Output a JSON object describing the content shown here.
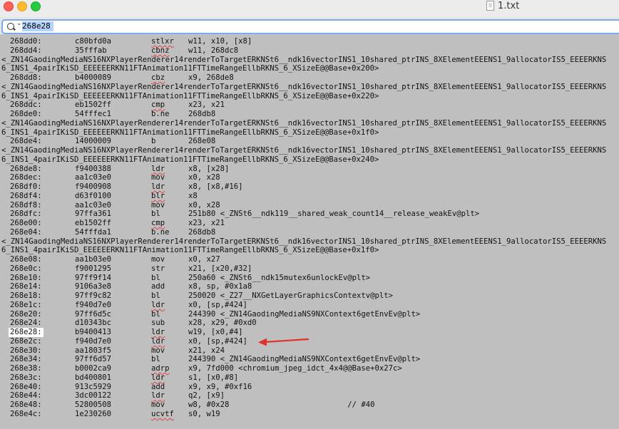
{
  "window": {
    "title": "1.txt"
  },
  "search": {
    "value": "268e28"
  },
  "lines": [
    {
      "type": "insn",
      "addr": "268dd0:",
      "hex": "c80bfd0a",
      "mn": "stlxr",
      "ops": "w11, x10, [x8]",
      "ul": true
    },
    {
      "type": "insn",
      "addr": "268dd4:",
      "hex": "35fffab",
      "mn": "cbnz",
      "ops": "w11, 268dc8",
      "ul": true
    },
    {
      "type": "sym",
      "text": "<_ZN14GaodingMediaNS16NXPlayerRenderer14renderToTargetERKNSt6__ndk16vectorINS1_10shared_ptrINS_8XElementEEENS1_9allocatorIS5_EEEERKNS"
    },
    {
      "type": "sym",
      "text": "6_INS1_4pairIKiSD_EEEEEERKN11FTAnimation11FTTimeRangeEllbRKNS_6_XSizeE@@Base+0x200>"
    },
    {
      "type": "insn",
      "addr": "268dd8:",
      "hex": "b4000089",
      "mn": "cbz",
      "ops": "x9, 268de8",
      "ul": true
    },
    {
      "type": "sym",
      "text": "<_ZN14GaodingMediaNS16NXPlayerRenderer14renderToTargetERKNSt6__ndk16vectorINS1_10shared_ptrINS_8XElementEEENS1_9allocatorIS5_EEEERKNS"
    },
    {
      "type": "sym",
      "text": "6_INS1_4pairIKiSD_EEEEEERKN11FTAnimation11FTTimeRangeEllbRKNS_6_XSizeE@@Base+0x220>"
    },
    {
      "type": "insn",
      "addr": "268ddc:",
      "hex": "eb1502ff",
      "mn": "cmp",
      "ops": "x23, x21",
      "ul": true
    },
    {
      "type": "insn",
      "addr": "268de0:",
      "hex": "54fffec1",
      "mn": "b.ne",
      "ops": "268db8",
      "ul": false
    },
    {
      "type": "sym",
      "text": "<_ZN14GaodingMediaNS16NXPlayerRenderer14renderToTargetERKNSt6__ndk16vectorINS1_10shared_ptrINS_8XElementEEENS1_9allocatorIS5_EEEERKNS"
    },
    {
      "type": "sym",
      "text": "6_INS1_4pairIKiSD_EEEEEERKN11FTAnimation11FTTimeRangeEllbRKNS_6_XSizeE@@Base+0x1f0>"
    },
    {
      "type": "insn",
      "addr": "268de4:",
      "hex": "14000009",
      "mn": "b",
      "ops": "268e08",
      "ul": false
    },
    {
      "type": "sym",
      "text": "<_ZN14GaodingMediaNS16NXPlayerRenderer14renderToTargetERKNSt6__ndk16vectorINS1_10shared_ptrINS_8XElementEEENS1_9allocatorIS5_EEEERKNS"
    },
    {
      "type": "sym",
      "text": "6_INS1_4pairIKiSD_EEEEEERKN11FTAnimation11FTTimeRangeEllbRKNS_6_XSizeE@@Base+0x240>"
    },
    {
      "type": "insn",
      "addr": "268de8:",
      "hex": "f9400388",
      "mn": "ldr",
      "ops": "x8, [x28]",
      "ul": true
    },
    {
      "type": "insn",
      "addr": "268dec:",
      "hex": "aa1c03e0",
      "mn": "mov",
      "ops": "x0, x28",
      "ul": false
    },
    {
      "type": "insn",
      "addr": "268df0:",
      "hex": "f9400908",
      "mn": "ldr",
      "ops": "x8, [x8,#16]",
      "ul": true
    },
    {
      "type": "insn",
      "addr": "268df4:",
      "hex": "d63f0100",
      "mn": "blr",
      "ops": "x8",
      "ul": true
    },
    {
      "type": "insn",
      "addr": "268df8:",
      "hex": "aa1c03e0",
      "mn": "mov",
      "ops": "x0, x28",
      "ul": false
    },
    {
      "type": "insn",
      "addr": "268dfc:",
      "hex": "97ffa361",
      "mn": "bl",
      "ops": "251b80 <_ZNSt6__ndk119__shared_weak_count14__release_weakEv@plt>",
      "ul": false
    },
    {
      "type": "insn",
      "addr": "268e00:",
      "hex": "eb1502ff",
      "mn": "cmp",
      "ops": "x23, x21",
      "ul": true
    },
    {
      "type": "insn",
      "addr": "268e04:",
      "hex": "54fffda1",
      "mn": "b.ne",
      "ops": "268db8",
      "ul": false
    },
    {
      "type": "sym",
      "text": "<_ZN14GaodingMediaNS16NXPlayerRenderer14renderToTargetERKNSt6__ndk16vectorINS1_10shared_ptrINS_8XElementEEENS1_9allocatorIS5_EEEERKNS"
    },
    {
      "type": "sym",
      "text": "6_INS1_4pairIKiSD_EEEEEERKN11FTAnimation11FTTimeRangeEllbRKNS_6_XSizeE@@Base+0x1f0>"
    },
    {
      "type": "insn",
      "addr": "268e08:",
      "hex": "aa1b03e0",
      "mn": "mov",
      "ops": "x0, x27",
      "ul": false
    },
    {
      "type": "insn",
      "addr": "268e0c:",
      "hex": "f9001295",
      "mn": "str",
      "ops": "x21, [x20,#32]",
      "ul": false
    },
    {
      "type": "insn",
      "addr": "268e10:",
      "hex": "97ff9f14",
      "mn": "bl",
      "ops": "250a60 <_ZNSt6__ndk15mutex6unlockEv@plt>",
      "ul": false
    },
    {
      "type": "insn",
      "addr": "268e14:",
      "hex": "9106a3e8",
      "mn": "add",
      "ops": "x8, sp, #0x1a8",
      "ul": false
    },
    {
      "type": "insn",
      "addr": "268e18:",
      "hex": "97ff9c82",
      "mn": "bl",
      "ops": "250020 <_Z27__NXGetLayerGraphicsContextv@plt>",
      "ul": false
    },
    {
      "type": "insn",
      "addr": "268e1c:",
      "hex": "f940d7e0",
      "mn": "ldr",
      "ops": "x0, [sp,#424]",
      "ul": true
    },
    {
      "type": "insn",
      "addr": "268e20:",
      "hex": "97ff6d5c",
      "mn": "bl",
      "ops": "244390 <_ZN14GaodingMediaNS9NXContext6getEnvEv@plt>",
      "ul": false
    },
    {
      "type": "insn",
      "addr": "268e24:",
      "hex": "d10343bc",
      "mn": "sub",
      "ops": "x28, x29, #0xd0",
      "ul": false
    },
    {
      "type": "insn",
      "addr": "268e28:",
      "hex": "b9400413",
      "mn": "ldr",
      "ops": "w19, [x0,#4]",
      "ul": true,
      "hl": true
    },
    {
      "type": "insn",
      "addr": "268e2c:",
      "hex": "f940d7e0",
      "mn": "ldr",
      "ops": "x0, [sp,#424]",
      "ul": true
    },
    {
      "type": "insn",
      "addr": "268e30:",
      "hex": "aa1803f5",
      "mn": "mov",
      "ops": "x21, x24",
      "ul": false
    },
    {
      "type": "insn",
      "addr": "268e34:",
      "hex": "97ff6d57",
      "mn": "bl",
      "ops": "244390 <_ZN14GaodingMediaNS9NXContext6getEnvEv@plt>",
      "ul": false
    },
    {
      "type": "insn",
      "addr": "268e38:",
      "hex": "b0002ca9",
      "mn": "adrp",
      "ops": "x9, 7fd000 <chromium_jpeg_idct_4x4@@Base+0x27c>",
      "ul": true
    },
    {
      "type": "insn",
      "addr": "268e3c:",
      "hex": "bd400801",
      "mn": "ldr",
      "ops": "s1, [x0,#8]",
      "ul": true
    },
    {
      "type": "insn",
      "addr": "268e40:",
      "hex": "913c5929",
      "mn": "add",
      "ops": "x9, x9, #0xf16",
      "ul": false
    },
    {
      "type": "insn",
      "addr": "268e44:",
      "hex": "3dc00122",
      "mn": "ldr",
      "ops": "q2, [x9]",
      "ul": true
    },
    {
      "type": "insn",
      "addr": "268e48:",
      "hex": "52800508",
      "mn": "mov",
      "ops": "w8, #0x28                          // #40",
      "ul": false
    },
    {
      "type": "insn",
      "addr": "268e4c:",
      "hex": "1e230260",
      "mn": "ucvtf",
      "ops": "s0, w19",
      "ul": true
    }
  ],
  "colors": {
    "arrow": "#e0322a",
    "background": "#bfbfbf",
    "focus": "#7aa7f0"
  }
}
